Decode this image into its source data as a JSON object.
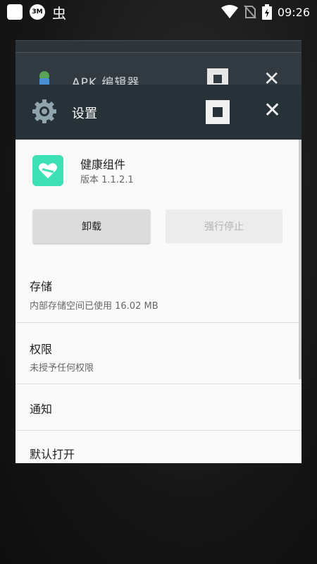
{
  "status_bar": {
    "left_icons": [
      "app-box-icon",
      "3m-icon",
      "bug-icon"
    ],
    "bug_glyph": "虫",
    "badge_3m": "3M",
    "time": "09:26",
    "right_icons": [
      "wifi-icon",
      "no-sim-icon",
      "battery-charging-icon"
    ]
  },
  "recents": {
    "back_card": {
      "title": "APK 编辑器",
      "icon": "android-icon"
    },
    "front_card": {
      "title": "设置",
      "icon": "gear-icon",
      "close_glyph": "✕"
    }
  },
  "app_info": {
    "name": "健康组件",
    "version": "版本 1.1.2.1"
  },
  "buttons": {
    "uninstall": "卸载",
    "force_stop": "强行停止"
  },
  "items": {
    "storage": {
      "title": "存储",
      "subtitle": "内部存储空间已使用 16.02 MB"
    },
    "permissions": {
      "title": "权限",
      "subtitle": "未授予任何权限"
    },
    "notifications": {
      "title": "通知"
    },
    "open_by_default": {
      "title": "默认打开"
    }
  },
  "colors": {
    "header_bg": "#263238",
    "app_icon": "#3ee0b6"
  }
}
